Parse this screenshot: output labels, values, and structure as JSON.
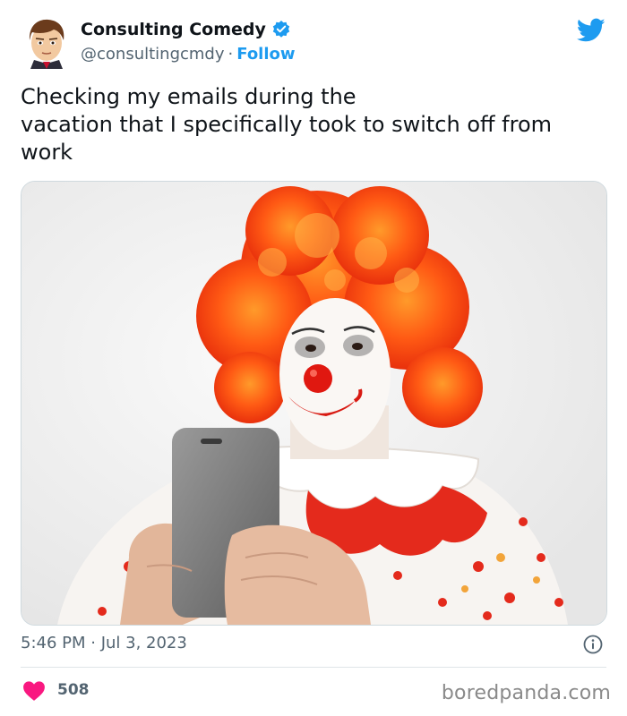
{
  "tweet": {
    "author": {
      "display_name": "Consulting Comedy",
      "handle": "@consultingcmdy",
      "separator": "·",
      "follow_label": "Follow",
      "verified": true
    },
    "text": "Checking my emails during the\nvacation that I specifically took to switch off from\nwork",
    "timestamp": "5:46 PM · Jul 3, 2023",
    "likes": "508",
    "icons": {
      "platform": "twitter-bird-icon",
      "verified": "verified-badge-icon",
      "info": "info-icon",
      "like": "heart-icon"
    },
    "colors": {
      "accent": "#1d9bf0",
      "like": "#f91880",
      "text": "#0f1419",
      "muted": "#536471"
    }
  },
  "watermark": "boredpanda.com"
}
